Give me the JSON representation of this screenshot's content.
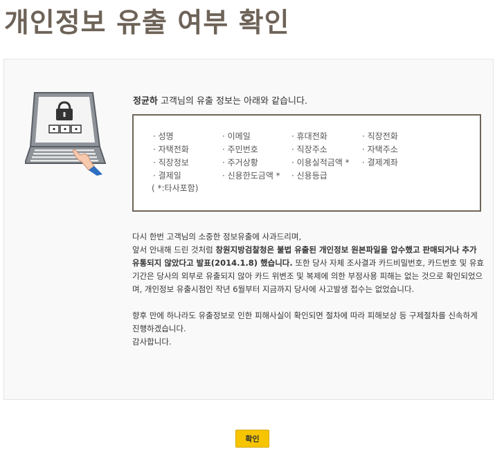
{
  "page": {
    "title": "개인정보 유출 여부 확인"
  },
  "greeting": {
    "name": "정균하",
    "suffix": " 고객님의 유출 정보는 아래와 같습니다."
  },
  "leak_items": [
    "· 성명",
    "· 이메일",
    "· 휴대전화",
    "· 직장전화",
    "· 자택전화",
    "· 주민번호",
    "· 직장주소",
    "· 자택주소",
    "· 직장정보",
    "· 주거상황",
    "· 이용실적금액 *",
    "· 결제계좌",
    "· 결제일",
    "· 신용한도금액 *",
    "· 신용등급"
  ],
  "leak_note": "( *:타사포함)",
  "message": {
    "p1_line1": "다시 한번 고객님의 소중한 정보유출에 사과드리며,",
    "p1_pre": "앞서 안내해 드린 것처럼 ",
    "p1_bold_org": "창원지방검찰청은 불법 유출된 개인정보 원본파일을 압수했고 판매되거나 추가 유통되지 않았다고 발표(2014.1.8) 했습니다.",
    "p1_post": " 또한 당사 자체 조사결과 카드비밀번호, 카드번호 및 유효기간은 당사의 외부로 유출되지 않아 카드 위변조 및 복제에 의한 부정사용 피해는 없는 것으로 확인되었으며, 개인정보 유출시점인 작년 6월부터 지금까지 당사에 사고발생 접수는 없었습니다.",
    "p2": "향후 만에 하나라도 유출정보로 인한 피해사실이 확인되면 절차에 따라 피해보상 등 구제절차를 신속하게 진행하겠습니다.",
    "p3": "감사합니다."
  },
  "buttons": {
    "confirm": "확인"
  },
  "colors": {
    "title": "#6e6358",
    "box_border": "#6e6358",
    "button": "#f7c500"
  }
}
